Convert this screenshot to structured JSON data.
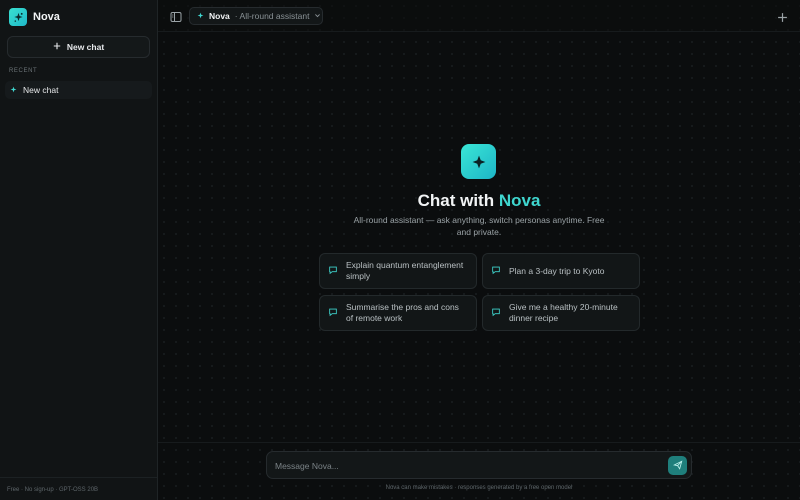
{
  "brand": {
    "name": "Nova",
    "accent": "#3fd6cf"
  },
  "sidebar": {
    "new_chat_label": "New chat",
    "recent_label": "RECENT",
    "recent_items": [
      {
        "label": "New chat"
      }
    ],
    "footer": "Free · No sign-up · GPT-OSS 20B"
  },
  "topbar": {
    "persona_name": "Nova",
    "persona_desc": "· All-round assistant"
  },
  "hero": {
    "title_prefix": "Chat with",
    "title_accent": "Nova",
    "subtitle": "All-round assistant — ask anything, switch personas anytime. Free and private."
  },
  "suggestions": [
    {
      "label": "Explain quantum entanglement simply"
    },
    {
      "label": "Plan a 3-day trip to Kyoto"
    },
    {
      "label": "Summarise the pros and cons of remote work"
    },
    {
      "label": "Give me a healthy 20-minute dinner recipe"
    }
  ],
  "composer": {
    "placeholder": "Message Nova...",
    "disclaimer": "Nova can make mistakes · responses generated by a free open model"
  }
}
